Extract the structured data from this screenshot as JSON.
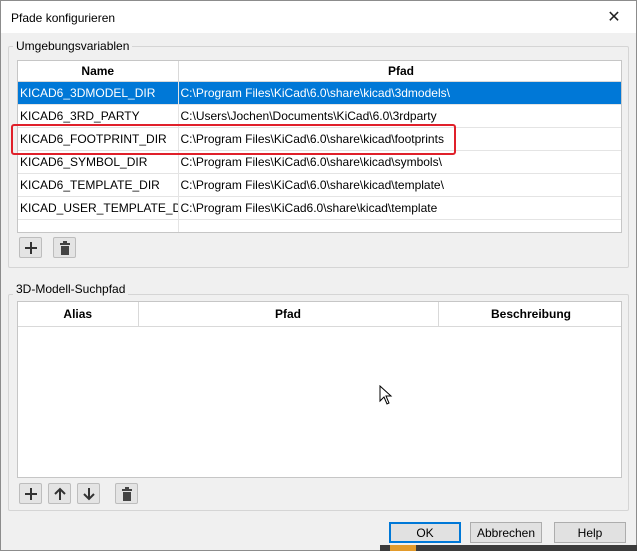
{
  "window": {
    "title": "Pfade konfigurieren"
  },
  "env_vars": {
    "group_label": "Umgebungsvariablen",
    "columns": {
      "name": "Name",
      "path": "Pfad"
    },
    "rows": [
      {
        "name": "KICAD6_3DMODEL_DIR",
        "path": "C:\\Program Files\\KiCad\\6.0\\share\\kicad\\3dmodels\\",
        "selected": true
      },
      {
        "name": "KICAD6_3RD_PARTY",
        "path": "C:\\Users\\Jochen\\Documents\\KiCad\\6.0\\3rdparty",
        "selected": false
      },
      {
        "name": "KICAD6_FOOTPRINT_DIR",
        "path": "C:\\Program Files\\KiCad\\6.0\\share\\kicad\\footprints",
        "selected": false
      },
      {
        "name": "KICAD6_SYMBOL_DIR",
        "path": "C:\\Program Files\\KiCad\\6.0\\share\\kicad\\symbols\\",
        "selected": false
      },
      {
        "name": "KICAD6_TEMPLATE_DIR",
        "path": "C:\\Program Files\\KiCad\\6.0\\share\\kicad\\template\\",
        "selected": false
      },
      {
        "name": "KICAD_USER_TEMPLATE_DIR",
        "path": "C:\\Program Files\\KiCad6.0\\share\\kicad\\template",
        "selected": false
      }
    ]
  },
  "search_path": {
    "group_label": "3D-Modell-Suchpfad",
    "columns": {
      "alias": "Alias",
      "path": "Pfad",
      "description": "Beschreibung"
    }
  },
  "buttons": {
    "ok": "OK",
    "cancel": "Abbrechen",
    "help": "Help"
  },
  "colors": {
    "selection": "#0078d7",
    "highlight_box": "#e0202a"
  },
  "icons": {
    "add": "plus-icon",
    "delete": "trash-icon",
    "move_up": "arrow-up-icon",
    "move_down": "arrow-down-icon",
    "close": "close-icon"
  }
}
